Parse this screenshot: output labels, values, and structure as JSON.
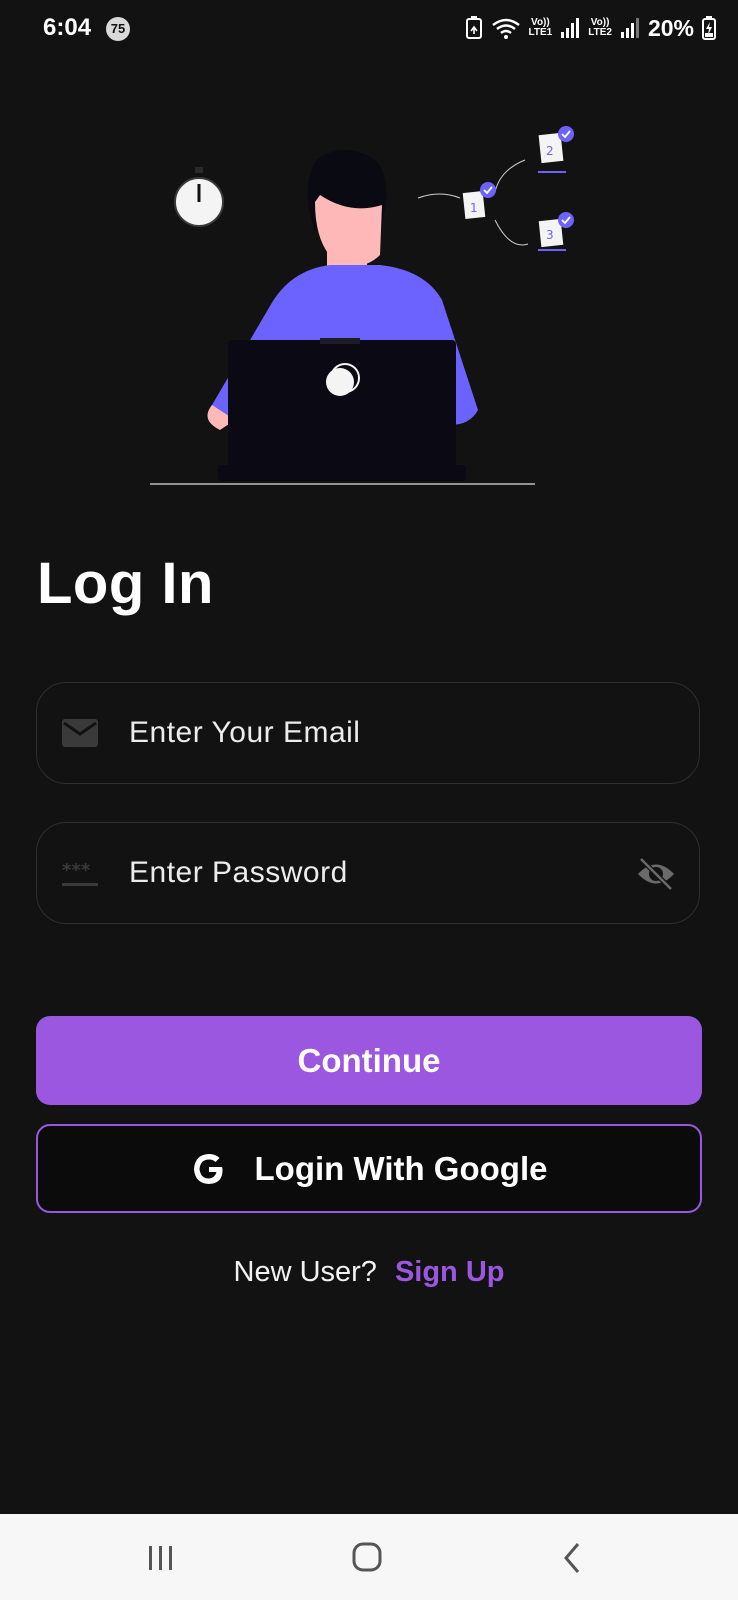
{
  "status_bar": {
    "time": "6:04",
    "notification_badge": "75",
    "sim1_label_top": "Vo))",
    "sim1_label_bottom": "LTE1",
    "sim2_label_top": "Vo))",
    "sim2_label_bottom": "LTE2",
    "battery_percent": "20%"
  },
  "illustration": {
    "step_labels": [
      "1",
      "2",
      "3"
    ],
    "accent_color": "#6c63ff"
  },
  "login": {
    "title": "Log In",
    "email_placeholder": "Enter Your Email",
    "password_placeholder": "Enter Password",
    "continue_label": "Continue",
    "google_label": "Login With Google",
    "new_user_text": "New User?",
    "signup_label": "Sign Up"
  },
  "colors": {
    "background": "#121212",
    "accent": "#9b57e0",
    "field_border": "#2f2f2f",
    "nav_bar": "#f7f7f7"
  },
  "icons": {
    "email_field": "mail-icon",
    "password_field": "password-dots-icon",
    "password_toggle": "eye-off-icon",
    "google": "google-g-icon",
    "nav": [
      "recent-apps-icon",
      "home-icon",
      "back-icon"
    ]
  }
}
